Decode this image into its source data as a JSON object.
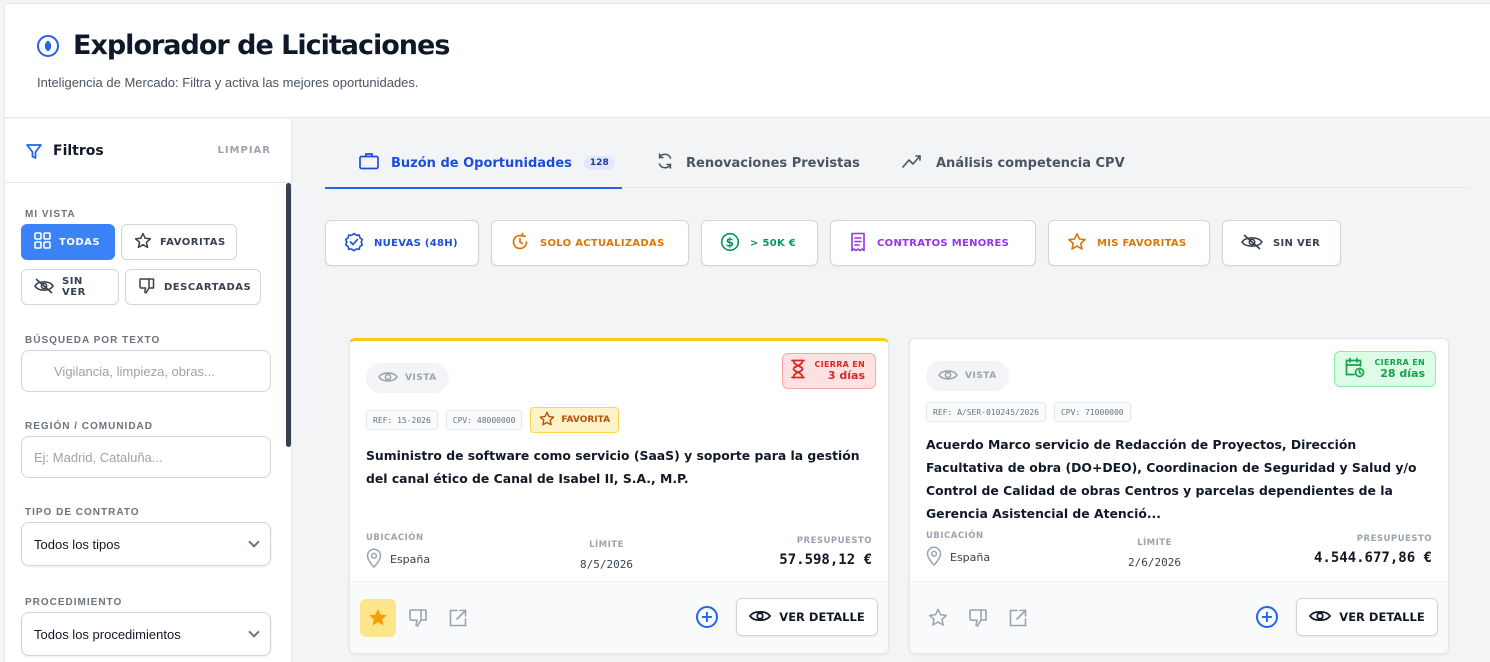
{
  "header": {
    "title": "Explorador de Licitaciones",
    "subtitle": "Inteligencia de Mercado: Filtra y activa las mejores oportunidades."
  },
  "sidebar": {
    "title": "Filtros",
    "clear_label": "LIMPIAR",
    "view_label": "MI VISTA",
    "views": [
      "TODAS",
      "FAVORITAS",
      "SIN VER",
      "DESCARTADAS"
    ],
    "active_view": "TODAS",
    "search": {
      "label": "BÚSQUEDA POR TEXTO",
      "placeholder": "Vigilancia, limpieza, obras..."
    },
    "region": {
      "label": "REGIÓN / COMUNIDAD",
      "placeholder": "Ej: Madrid, Cataluña..."
    },
    "contract_type": {
      "label": "TIPO DE CONTRATO",
      "value": "Todos los tipos"
    },
    "procedure": {
      "label": "PROCEDIMIENTO",
      "value": "Todos los procedimientos"
    }
  },
  "tabs": [
    {
      "label": "Buzón de Oportunidades",
      "badge": "128",
      "active": true
    },
    {
      "label": "Renovaciones Previstas",
      "active": false
    },
    {
      "label": "Análisis competencia CPV",
      "active": false
    }
  ],
  "quick_filters": [
    {
      "label": "NUEVAS (48H)",
      "color": "#1d4ed8"
    },
    {
      "label": "SOLO ACTUALIZADAS",
      "color": "#d97706"
    },
    {
      "label": "> 50K €",
      "color": "#059669"
    },
    {
      "label": "CONTRATOS MENORES",
      "color": "#9333ea"
    },
    {
      "label": "MIS FAVORITAS",
      "color": "#d97706"
    },
    {
      "label": "SIN VER",
      "color": "#374151"
    }
  ],
  "cards": [
    {
      "seen_label": "VISTA",
      "closes_label": "CIERRA EN",
      "closes_value": "3 días",
      "ref": "REF: 15-2026",
      "cpv": "CPV: 48000000",
      "fav_label": "FAVORITA",
      "title": "Suministro de software como servicio (SaaS) y soporte para la gestión del canal ético de Canal de Isabel II, S.A., M.P.",
      "location_label": "UBICACIÓN",
      "location": "España",
      "deadline_label": "LÍMITE",
      "deadline": "8/5/2026",
      "budget_label": "PRESUPUESTO",
      "budget": "57.598,12 €",
      "detail_label": "VER DETALLE"
    },
    {
      "seen_label": "VISTA",
      "closes_label": "CIERRA EN",
      "closes_value": "28 días",
      "ref": "REF: A/SER-010245/2026",
      "cpv": "CPV: 71000000",
      "title": "Acuerdo Marco servicio de Redacción de Proyectos, Dirección Facultativa de obra (DO+DEO), Coordinacion de Seguridad y Salud y/o Control de Calidad de obras Centros y parcelas dependientes de la Gerencia Asistencial de Atenció...",
      "location_label": "UBICACIÓN",
      "location": "España",
      "deadline_label": "LÍMITE",
      "deadline": "2/6/2026",
      "budget_label": "PRESUPUESTO",
      "budget": "4.544.677,86 €",
      "detail_label": "VER DETALLE"
    }
  ],
  "colors": {
    "accent": "#2563eb",
    "urgent": "#dc2626",
    "ok": "#16a34a",
    "favorite": "#f59e0b"
  }
}
